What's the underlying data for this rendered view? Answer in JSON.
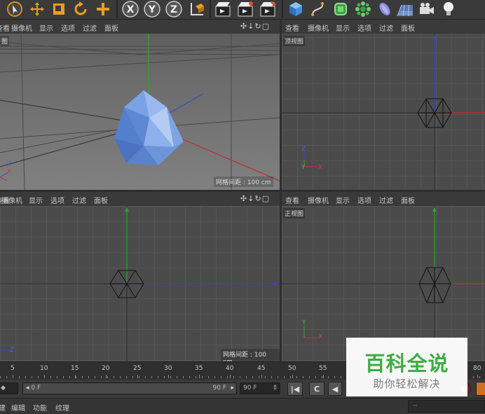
{
  "toolbar": {
    "axis_x": "X",
    "axis_y": "Y",
    "axis_z": "Z"
  },
  "viewport_menu": {
    "view": "查看",
    "camera": "摄像机",
    "display": "显示",
    "options": "选项",
    "filter": "过滤",
    "panel": "面板"
  },
  "viewports": {
    "top_label": "顶视图",
    "front_label": "正视图",
    "persp_label": "图",
    "grid_spacing": "网格间距 : 100 cm",
    "nav_icons": "✣↓↻▢"
  },
  "axis_labels": {
    "x": "X",
    "y": "Y",
    "z": "Z"
  },
  "timeline": {
    "ticks": [
      "5",
      "10",
      "15",
      "20",
      "25",
      "30",
      "35",
      "40",
      "45",
      "50",
      "55",
      "80"
    ]
  },
  "playback": {
    "current_frame": "0 F",
    "range_end": "90 F",
    "max_frame": "90 F"
  },
  "menubar": {
    "create": "建",
    "edit": "编辑",
    "function": "功能",
    "texture": "纹理"
  },
  "watermark": {
    "title": "百科全说",
    "subtitle": "助你轻松解决"
  },
  "status": {
    "text": "--"
  },
  "colors": {
    "axis_x": "#c83232",
    "axis_y": "#2ea52e",
    "axis_z": "#3c46c8",
    "object_fill": "#6f96de",
    "brand_green": "#3cae41"
  }
}
